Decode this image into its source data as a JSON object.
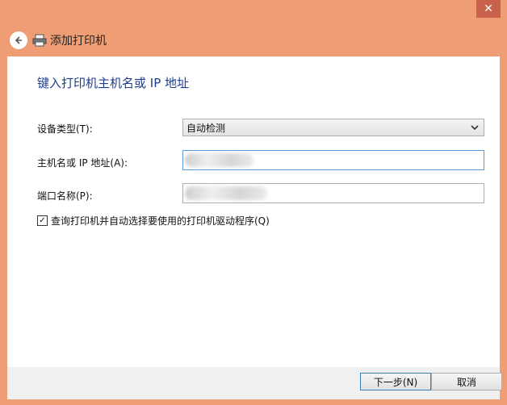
{
  "window": {
    "title": "添加打印机",
    "close_glyph": "✕"
  },
  "main": {
    "heading": "键入打印机主机名或 IP 地址",
    "device_type": {
      "label": "设备类型(T):",
      "value": "自动检测"
    },
    "host": {
      "label": "主机名或 IP 地址(A):",
      "value": ""
    },
    "port": {
      "label": "端口名称(P):",
      "value": ""
    },
    "query_driver": {
      "label": "查询打印机并自动选择要使用的打印机驱动程序(Q)",
      "checked": true
    }
  },
  "footer": {
    "next_label": "下一步(N)",
    "cancel_label": "取消"
  },
  "colors": {
    "frame": "#ef9d74",
    "heading": "#1e3d8f",
    "focus_border": "#569de5"
  }
}
